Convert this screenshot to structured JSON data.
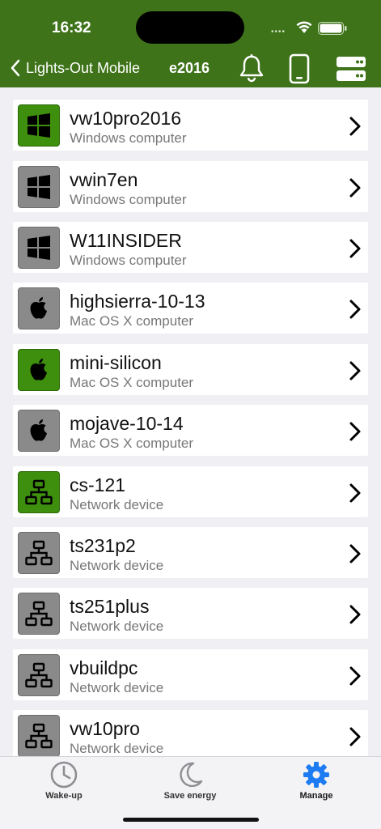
{
  "status_bar": {
    "time": "16:32",
    "signal": "••••"
  },
  "nav": {
    "back_label": "Lights-Out Mobile",
    "title": "e2016"
  },
  "devices": [
    {
      "name": "vw10pro2016",
      "subtitle": "Windows computer",
      "icon": "windows-icon",
      "state": "on"
    },
    {
      "name": "vwin7en",
      "subtitle": "Windows computer",
      "icon": "windows-icon",
      "state": "off"
    },
    {
      "name": "W11INSIDER",
      "subtitle": "Windows computer",
      "icon": "windows-icon",
      "state": "off"
    },
    {
      "name": "highsierra-10-13",
      "subtitle": "Mac OS X computer",
      "icon": "apple-icon",
      "state": "off"
    },
    {
      "name": "mini-silicon",
      "subtitle": "Mac OS X computer",
      "icon": "apple-icon",
      "state": "on"
    },
    {
      "name": "mojave-10-14",
      "subtitle": "Mac OS X computer",
      "icon": "apple-icon",
      "state": "off"
    },
    {
      "name": "cs-121",
      "subtitle": "Network device",
      "icon": "network-icon",
      "state": "on"
    },
    {
      "name": "ts231p2",
      "subtitle": "Network device",
      "icon": "network-icon",
      "state": "off"
    },
    {
      "name": "ts251plus",
      "subtitle": "Network device",
      "icon": "network-icon",
      "state": "off"
    },
    {
      "name": "vbuildpc",
      "subtitle": "Network device",
      "icon": "network-icon",
      "state": "off"
    },
    {
      "name": "vw10pro",
      "subtitle": "Network device",
      "icon": "network-icon",
      "state": "off"
    }
  ],
  "tabs": [
    {
      "label": "Wake-up",
      "icon": "clock-icon",
      "active": false
    },
    {
      "label": "Save energy",
      "icon": "moon-icon",
      "active": false
    },
    {
      "label": "Manage",
      "icon": "gear-icon",
      "active": true
    }
  ],
  "colors": {
    "brand_green": "#3e7319",
    "on_green": "#3e8f0d",
    "off_gray": "#8a8a8a",
    "active_blue": "#1e7cf2"
  }
}
